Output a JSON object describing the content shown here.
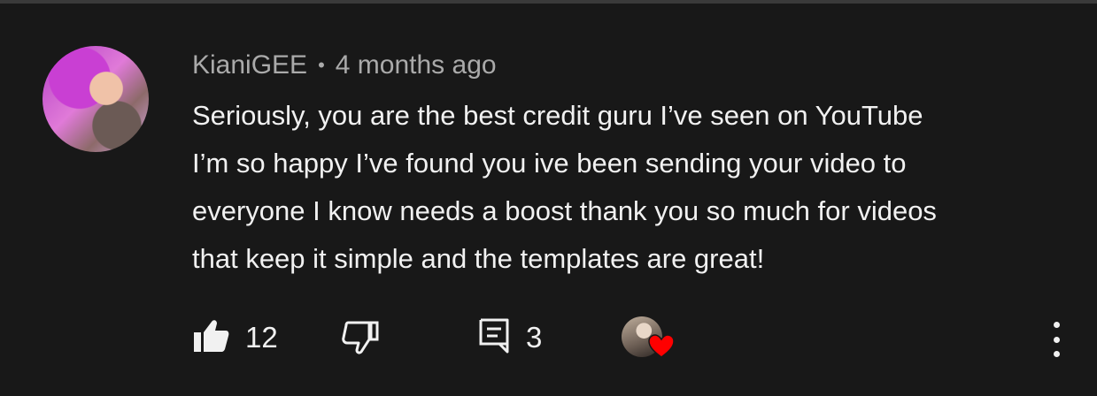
{
  "comment": {
    "author": "KianiGEE",
    "separator": "•",
    "timestamp": "4 months ago",
    "lines": [
      "Seriously, you are the best credit guru I’ve seen on YouTube",
      "I’m so happy I’ve found you ive been sending your video to",
      "everyone I know needs a boost thank you so much for videos",
      "that keep it simple and the templates are great!"
    ]
  },
  "actions": {
    "like_count": "12",
    "reply_count": "3",
    "heart_color": "#ff0000"
  },
  "icons": {
    "like": "thumbs-up-icon",
    "dislike": "thumbs-down-icon",
    "reply": "comment-icon",
    "heart": "heart-icon",
    "menu": "more-vert-icon"
  }
}
